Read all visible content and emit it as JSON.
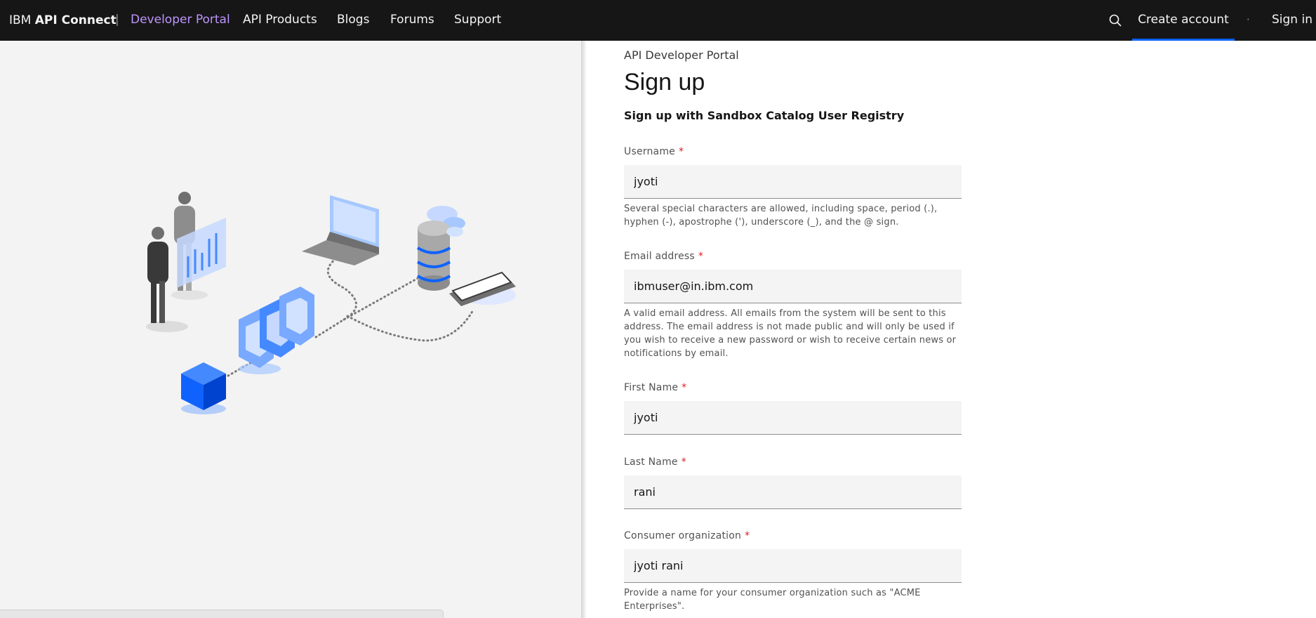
{
  "nav": {
    "brand_prefix": "IBM ",
    "brand_bold": "API Connect",
    "separator": "|",
    "portal": "Developer Portal",
    "links": [
      "API Products",
      "Blogs",
      "Forums",
      "Support"
    ],
    "create_account": "Create account",
    "dot": "·",
    "sign_in": "Sign in",
    "search_icon": "search-icon",
    "accent_color": "#be95ff",
    "active_underline": "#0f62fe"
  },
  "page": {
    "eyebrow": "API Developer Portal",
    "title": "Sign up",
    "subtitle": "Sign up with Sandbox Catalog User Registry"
  },
  "form": {
    "required_mark": "*",
    "username": {
      "label": "Username",
      "value": "jyoti",
      "helper": "Several special characters are allowed, including space, period (.), hyphen (-), apostrophe ('), underscore (_), and the @ sign."
    },
    "email": {
      "label": "Email address",
      "value": "ibmuser@in.ibm.com",
      "helper": "A valid email address. All emails from the system will be sent to this address. The email address is not made public and will only be used if you wish to receive a new password or wish to receive certain news or notifications by email."
    },
    "first_name": {
      "label": "First Name",
      "value": "jyoti"
    },
    "last_name": {
      "label": "Last Name",
      "value": "rani"
    },
    "consumer_org": {
      "label": "Consumer organization",
      "value": "jyoti rani",
      "helper": "Provide a name for your consumer organization such as \"ACME Enterprises\"."
    }
  }
}
